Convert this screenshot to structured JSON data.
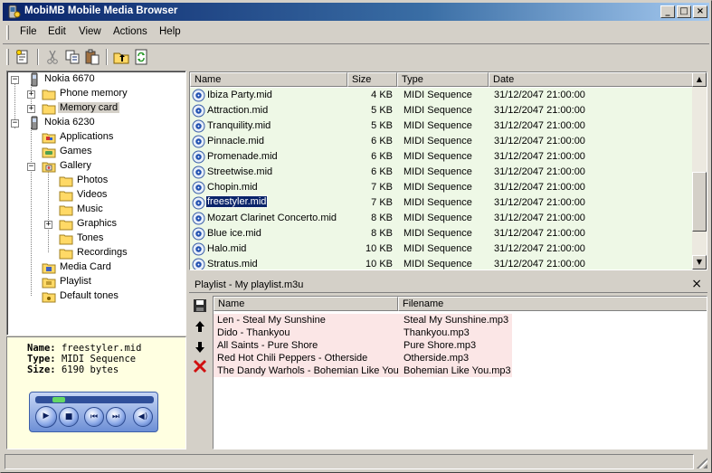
{
  "window": {
    "title": "MobiMB Mobile Media Browser",
    "minimize": "_",
    "maximize": "□",
    "close": "×"
  },
  "menu": [
    "File",
    "Edit",
    "View",
    "Actions",
    "Help"
  ],
  "tree": [
    {
      "label": "Nokia 6670",
      "icon": "phone-icon",
      "expander": "−"
    },
    {
      "label": "Phone memory",
      "icon": "folder-icon",
      "expander": "+"
    },
    {
      "label": "Memory card",
      "icon": "folder-icon",
      "expander": "+"
    },
    {
      "label": "Nokia 6230",
      "icon": "phone-icon",
      "expander": "−"
    },
    {
      "label": "Applications",
      "icon": "folder-apps-icon",
      "expander": ""
    },
    {
      "label": "Games",
      "icon": "folder-games-icon",
      "expander": ""
    },
    {
      "label": "Gallery",
      "icon": "folder-gallery-icon",
      "expander": "−"
    },
    {
      "label": "Photos",
      "icon": "folder-icon",
      "expander": ""
    },
    {
      "label": "Videos",
      "icon": "folder-icon",
      "expander": ""
    },
    {
      "label": "Music",
      "icon": "folder-icon",
      "expander": ""
    },
    {
      "label": "Graphics",
      "icon": "folder-icon",
      "expander": "+"
    },
    {
      "label": "Tones",
      "icon": "folder-icon",
      "expander": ""
    },
    {
      "label": "Recordings",
      "icon": "folder-icon",
      "expander": ""
    },
    {
      "label": "Media Card",
      "icon": "folder-card-icon",
      "expander": ""
    },
    {
      "label": "Playlist",
      "icon": "folder-playlist-icon",
      "expander": ""
    },
    {
      "label": "Default tones",
      "icon": "folder-tones-icon",
      "expander": ""
    }
  ],
  "info": {
    "name_label": "Name:",
    "name": "freestyler.mid",
    "type_label": "Type:",
    "type": "MIDI Sequence",
    "size_label": "Size:",
    "size": "6190 bytes",
    "player_progress": 0.2
  },
  "files": {
    "columns": [
      "Name",
      "Size",
      "Type",
      "Date"
    ],
    "rows": [
      {
        "name": "Ibiza Party.mid",
        "size": "4 KB",
        "type": "MIDI Sequence",
        "date": "31/12/2047 21:00:00"
      },
      {
        "name": "Attraction.mid",
        "size": "5 KB",
        "type": "MIDI Sequence",
        "date": "31/12/2047 21:00:00"
      },
      {
        "name": "Tranquility.mid",
        "size": "5 KB",
        "type": "MIDI Sequence",
        "date": "31/12/2047 21:00:00"
      },
      {
        "name": "Pinnacle.mid",
        "size": "6 KB",
        "type": "MIDI Sequence",
        "date": "31/12/2047 21:00:00"
      },
      {
        "name": "Promenade.mid",
        "size": "6 KB",
        "type": "MIDI Sequence",
        "date": "31/12/2047 21:00:00"
      },
      {
        "name": "Streetwise.mid",
        "size": "6 KB",
        "type": "MIDI Sequence",
        "date": "31/12/2047 21:00:00"
      },
      {
        "name": "Chopin.mid",
        "size": "7 KB",
        "type": "MIDI Sequence",
        "date": "31/12/2047 21:00:00"
      },
      {
        "name": "freestyler.mid",
        "size": "7 KB",
        "type": "MIDI Sequence",
        "date": "31/12/2047 21:00:00",
        "selected": true
      },
      {
        "name": "Mozart Clarinet Concerto.mid",
        "size": "8 KB",
        "type": "MIDI Sequence",
        "date": "31/12/2047 21:00:00"
      },
      {
        "name": "Blue ice.mid",
        "size": "8 KB",
        "type": "MIDI Sequence",
        "date": "31/12/2047 21:00:00"
      },
      {
        "name": "Halo.mid",
        "size": "10 KB",
        "type": "MIDI Sequence",
        "date": "31/12/2047 21:00:00"
      },
      {
        "name": "Stratus.mid",
        "size": "10 KB",
        "type": "MIDI Sequence",
        "date": "31/12/2047 21:00:00"
      }
    ]
  },
  "playlist": {
    "title": "Playlist - My playlist.m3u",
    "close": "×",
    "columns": [
      "Name",
      "Filename"
    ],
    "rows": [
      {
        "name": "Len - Steal My Sunshine",
        "filename": "Steal My Sunshine.mp3"
      },
      {
        "name": "Dido - Thankyou",
        "filename": "Thankyou.mp3"
      },
      {
        "name": "All Saints - Pure Shore",
        "filename": "Pure Shore.mp3"
      },
      {
        "name": "Red Hot Chili Peppers - Otherside",
        "filename": "Otherside.mp3"
      },
      {
        "name": "The Dandy Warhols - Bohemian Like You",
        "filename": "Bohemian Like You.mp3"
      }
    ]
  },
  "colors": {
    "title_gradient_start": "#0a246a",
    "file_row_bg": "#eef8e6",
    "playlist_row_bg": "#fbe6e6",
    "selection": "#0a246a",
    "info_bg": "#ffffe1"
  }
}
